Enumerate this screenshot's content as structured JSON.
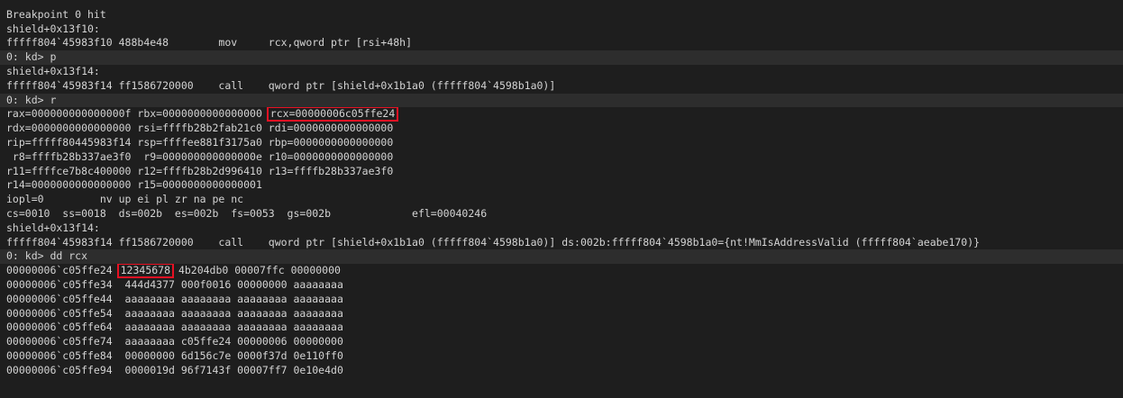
{
  "colors": {
    "background": "#1e1e1e",
    "prompt_background": "#2d2d2d",
    "text": "#d4d4d4",
    "highlight_box": "#e81123"
  },
  "lines": [
    {
      "type": "output",
      "text": "                                   "
    },
    {
      "type": "output",
      "text": "Breakpoint 0 hit"
    },
    {
      "type": "output",
      "text": "shield+0x13f10:"
    },
    {
      "type": "output",
      "text": "fffff804`45983f10 488b4e48        mov     rcx,qword ptr [rsi+48h]"
    },
    {
      "type": "prompt",
      "text": "0: kd> p"
    },
    {
      "type": "output",
      "text": "shield+0x13f14:"
    },
    {
      "type": "output",
      "text": "fffff804`45983f14 ff1586720000    call    qword ptr [shield+0x1b1a0 (fffff804`4598b1a0)]"
    },
    {
      "type": "prompt",
      "text": "0: kd> r"
    },
    {
      "type": "regline",
      "pre": "rax=000000000000000f rbx=0000000000000000 ",
      "hl": "rcx=00000006c05ffe24",
      "post": ""
    },
    {
      "type": "output",
      "text": "rdx=0000000000000000 rsi=ffffb28b2fab21c0 rdi=0000000000000000"
    },
    {
      "type": "output",
      "text": "rip=fffff80445983f14 rsp=ffffee881f3175a0 rbp=0000000000000000"
    },
    {
      "type": "output",
      "text": " r8=ffffb28b337ae3f0  r9=000000000000000e r10=0000000000000000"
    },
    {
      "type": "output",
      "text": "r11=ffffce7b8c400000 r12=ffffb28b2d996410 r13=ffffb28b337ae3f0"
    },
    {
      "type": "output",
      "text": "r14=0000000000000000 r15=0000000000000001"
    },
    {
      "type": "output",
      "text": "iopl=0         nv up ei pl zr na pe nc"
    },
    {
      "type": "output",
      "text": "cs=0010  ss=0018  ds=002b  es=002b  fs=0053  gs=002b             efl=00040246"
    },
    {
      "type": "output",
      "text": "shield+0x13f14:"
    },
    {
      "type": "output",
      "text": "fffff804`45983f14 ff1586720000    call    qword ptr [shield+0x1b1a0 (fffff804`4598b1a0)] ds:002b:fffff804`4598b1a0={nt!MmIsAddressValid (fffff804`aeabe170)}"
    },
    {
      "type": "prompt",
      "text": "0: kd> dd rcx"
    },
    {
      "type": "regline",
      "pre": "00000006`c05ffe24 ",
      "hl": "12345678",
      "post": " 4b204db0 00007ffc 00000000"
    },
    {
      "type": "output",
      "text": "00000006`c05ffe34  444d4377 000f0016 00000000 aaaaaaaa"
    },
    {
      "type": "output",
      "text": "00000006`c05ffe44  aaaaaaaa aaaaaaaa aaaaaaaa aaaaaaaa"
    },
    {
      "type": "output",
      "text": "00000006`c05ffe54  aaaaaaaa aaaaaaaa aaaaaaaa aaaaaaaa"
    },
    {
      "type": "output",
      "text": "00000006`c05ffe64  aaaaaaaa aaaaaaaa aaaaaaaa aaaaaaaa"
    },
    {
      "type": "output",
      "text": "00000006`c05ffe74  aaaaaaaa c05ffe24 00000006 00000000"
    },
    {
      "type": "output",
      "text": "00000006`c05ffe84  00000000 6d156c7e 0000f37d 0e110ff0"
    },
    {
      "type": "output",
      "text": "00000006`c05ffe94  0000019d 96f7143f 00007ff7 0e10e4d0"
    }
  ]
}
